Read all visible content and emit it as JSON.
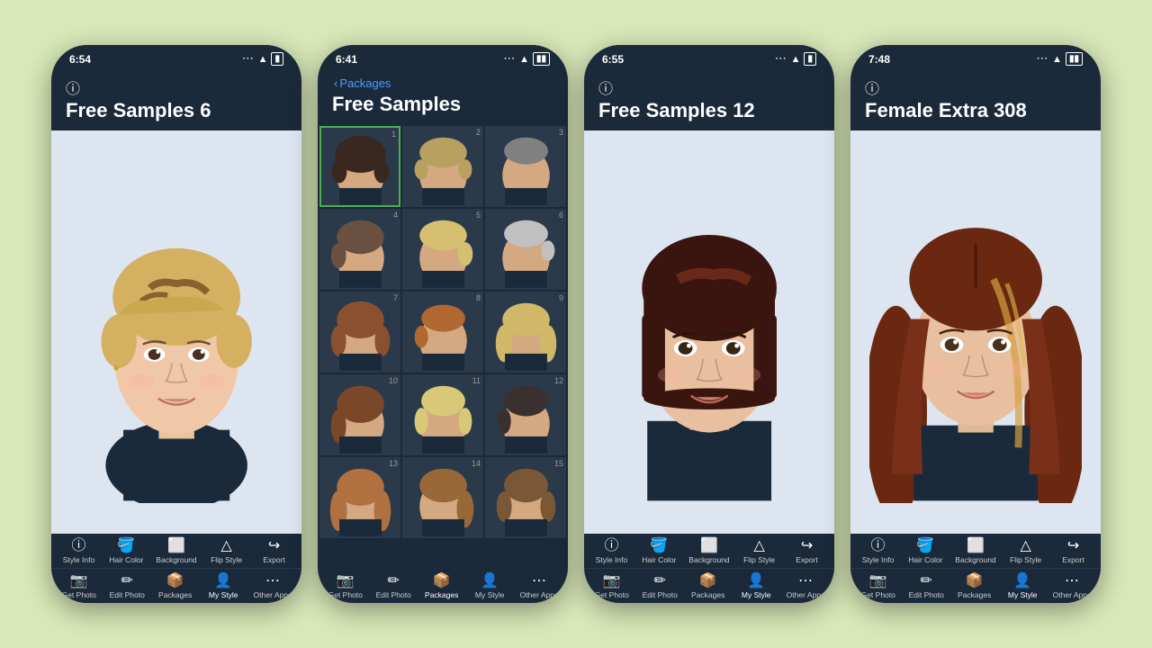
{
  "background_color": "#d8e8b8",
  "phones": [
    {
      "id": "phone1",
      "status_time": "6:54",
      "header_title": "Free Samples 6",
      "has_info_icon": true,
      "has_back": false,
      "view_type": "single",
      "toolbar_top": [
        {
          "icon": "ℹ",
          "label": "Style Info",
          "active": false
        },
        {
          "icon": "🪣",
          "label": "Hair Color",
          "active": false
        },
        {
          "icon": "🖼",
          "label": "Background",
          "active": false
        },
        {
          "icon": "▲",
          "label": "Flip Style",
          "active": false
        },
        {
          "icon": "↪",
          "label": "Export",
          "active": false
        }
      ],
      "toolbar_bottom": [
        {
          "icon": "📷",
          "label": "Get Photo",
          "active": false
        },
        {
          "icon": "✏",
          "label": "Edit Photo",
          "active": false
        },
        {
          "icon": "📦",
          "label": "Packages",
          "active": false
        },
        {
          "icon": "👤",
          "label": "My Style",
          "active": true
        },
        {
          "icon": "⋯",
          "label": "Other Apps",
          "active": false
        }
      ]
    },
    {
      "id": "phone2",
      "status_time": "6:41",
      "header_title": "Free Samples",
      "has_info_icon": false,
      "has_back": true,
      "back_label": "Packages",
      "view_type": "grid",
      "grid_count": 15,
      "selected_item": 1,
      "toolbar_bottom": [
        {
          "icon": "📷",
          "label": "Get Photo",
          "active": false
        },
        {
          "icon": "✏",
          "label": "Edit Photo",
          "active": false
        },
        {
          "icon": "📦",
          "label": "Packages",
          "active": true
        },
        {
          "icon": "👤",
          "label": "My Style",
          "active": false
        },
        {
          "icon": "⋯",
          "label": "Other Apps",
          "active": false
        }
      ]
    },
    {
      "id": "phone3",
      "status_time": "6:55",
      "header_title": "Free Samples 12",
      "has_info_icon": true,
      "has_back": false,
      "view_type": "single",
      "toolbar_top": [
        {
          "icon": "ℹ",
          "label": "Style Info",
          "active": false
        },
        {
          "icon": "🪣",
          "label": "Hair Color",
          "active": false
        },
        {
          "icon": "🖼",
          "label": "Background",
          "active": false
        },
        {
          "icon": "▲",
          "label": "Flip Style",
          "active": false
        },
        {
          "icon": "↪",
          "label": "Export",
          "active": false
        }
      ],
      "toolbar_bottom": [
        {
          "icon": "📷",
          "label": "Get Photo",
          "active": false
        },
        {
          "icon": "✏",
          "label": "Edit Photo",
          "active": false
        },
        {
          "icon": "📦",
          "label": "Packages",
          "active": false
        },
        {
          "icon": "👤",
          "label": "My Style",
          "active": true
        },
        {
          "icon": "⋯",
          "label": "Other Apps",
          "active": false
        }
      ]
    },
    {
      "id": "phone4",
      "status_time": "7:48",
      "header_title": "Female Extra 308",
      "has_info_icon": true,
      "has_back": false,
      "view_type": "single",
      "toolbar_top": [
        {
          "icon": "ℹ",
          "label": "Style Info",
          "active": false
        },
        {
          "icon": "🪣",
          "label": "Hair Color",
          "active": false
        },
        {
          "icon": "🖼",
          "label": "Background",
          "active": false
        },
        {
          "icon": "▲",
          "label": "Flip Style",
          "active": false
        },
        {
          "icon": "↪",
          "label": "Export",
          "active": false
        }
      ],
      "toolbar_bottom": [
        {
          "icon": "📷",
          "label": "Get Photo",
          "active": false
        },
        {
          "icon": "✏",
          "label": "Edit Photo",
          "active": false
        },
        {
          "icon": "📦",
          "label": "Packages",
          "active": false
        },
        {
          "icon": "👤",
          "label": "My Style",
          "active": true
        },
        {
          "icon": "⋯",
          "label": "Other Apps",
          "active": false
        }
      ]
    }
  ]
}
